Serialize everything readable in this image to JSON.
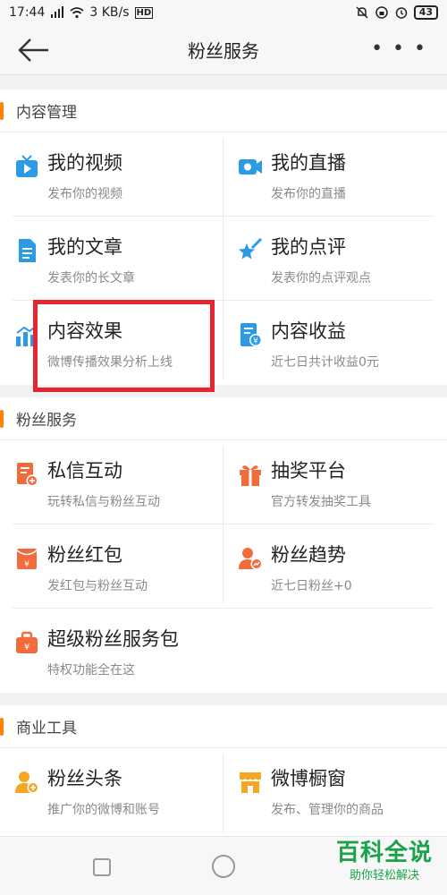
{
  "status_bar": {
    "time": "17:44",
    "network_speed": "3 KB/s",
    "hd_badge": "HD",
    "battery": "43"
  },
  "nav": {
    "title": "粉丝服务",
    "more": "• • •"
  },
  "sections": [
    {
      "title": "内容管理",
      "items": [
        {
          "title": "我的视频",
          "subtitle": "发布你的视频",
          "icon": "tv-icon"
        },
        {
          "title": "我的直播",
          "subtitle": "发布你的直播",
          "icon": "camera-icon"
        },
        {
          "title": "我的文章",
          "subtitle": "发表你的长文章",
          "icon": "document-icon"
        },
        {
          "title": "我的点评",
          "subtitle": "发表你的点评观点",
          "icon": "star-pen-icon"
        },
        {
          "title": "内容效果",
          "subtitle": "微博传播效果分析上线",
          "icon": "bar-chart-icon"
        },
        {
          "title": "内容收益",
          "subtitle": "近七日共计收益0元",
          "icon": "revenue-icon"
        }
      ]
    },
    {
      "title": "粉丝服务",
      "items": [
        {
          "title": "私信互动",
          "subtitle": "玩转私信与粉丝互动",
          "icon": "message-icon"
        },
        {
          "title": "抽奖平台",
          "subtitle": "官方转发抽奖工具",
          "icon": "gift-icon"
        },
        {
          "title": "粉丝红包",
          "subtitle": "发红包与粉丝互动",
          "icon": "red-packet-icon"
        },
        {
          "title": "粉丝趋势",
          "subtitle": "近七日粉丝+0",
          "icon": "fan-trend-icon"
        },
        {
          "title": "超级粉丝服务包",
          "subtitle": "特权功能全在这",
          "icon": "service-pack-icon"
        }
      ]
    },
    {
      "title": "商业工具",
      "items": [
        {
          "title": "粉丝头条",
          "subtitle": "推广你的微博和账号",
          "icon": "fan-headline-icon"
        },
        {
          "title": "微博橱窗",
          "subtitle": "发布、管理你的商品",
          "icon": "shop-window-icon"
        }
      ]
    }
  ],
  "watermark": {
    "line1": "百科全说",
    "line2": "助你轻松解决"
  },
  "colors": {
    "accent": "#ff8200",
    "highlight": "#e5262e",
    "blue": "#2b9be8",
    "orange": "#f26b3a",
    "yellow": "#f5a623"
  }
}
